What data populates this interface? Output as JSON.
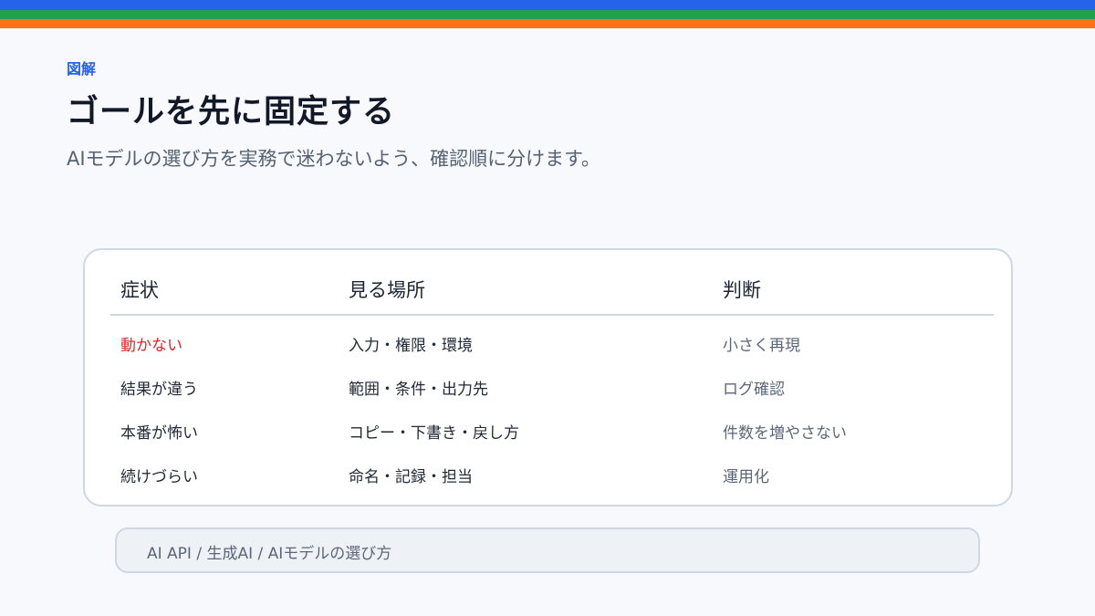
{
  "header": {
    "eyebrow": "図解",
    "title": "ゴールを先に固定する",
    "subtitle": "AIモデルの選び方を実務で迷わないよう、確認順に分けます。"
  },
  "colors": {
    "stripe_blue": "#2563eb",
    "stripe_green": "#22a04b",
    "stripe_orange": "#f97316",
    "accent": "#2563eb",
    "danger": "#dc2626"
  },
  "table": {
    "columns": [
      "症状",
      "見る場所",
      "判断"
    ],
    "rows": [
      {
        "symptom": "動かない",
        "where": "入力・権限・環境",
        "judgment": "小さく再現"
      },
      {
        "symptom": "結果が違う",
        "where": "範囲・条件・出力先",
        "judgment": "ログ確認"
      },
      {
        "symptom": "本番が怖い",
        "where": "コピー・下書き・戻し方",
        "judgment": "件数を増やさない"
      },
      {
        "symptom": "続けづらい",
        "where": "命名・記録・担当",
        "judgment": "運用化"
      }
    ]
  },
  "breadcrumb": "AI API / 生成AI / AIモデルの選び方"
}
